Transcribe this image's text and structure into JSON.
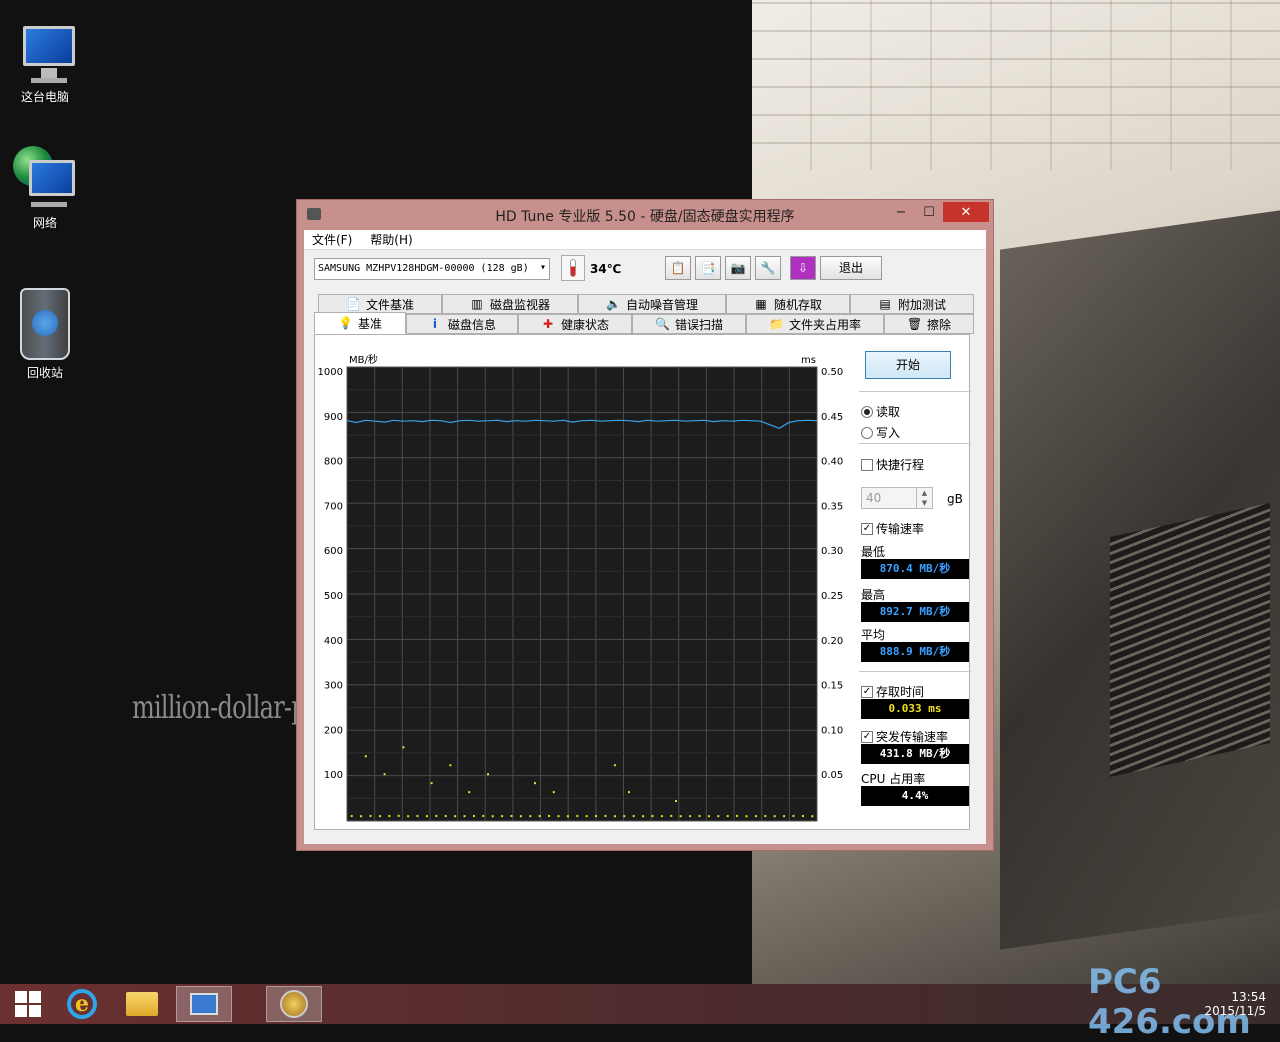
{
  "desktop": {
    "icons": [
      {
        "label": "这台电脑",
        "icon": "computer-icon"
      },
      {
        "label": "网络",
        "icon": "network-icon"
      },
      {
        "label": "回收站",
        "icon": "recycle-bin-icon"
      }
    ],
    "watermark": "million-dollar-p"
  },
  "window": {
    "title": "HD Tune 专业版 5.50 - 硬盘/固态硬盘实用程序",
    "controls": {
      "minimize": "−",
      "maximize": "☐",
      "close": "✕"
    },
    "menu": {
      "file": "文件(F)",
      "help": "帮助(H)"
    },
    "toolbar": {
      "drive": "SAMSUNG MZHPV128HDGM-00000 (128 gB)",
      "temperature": "34℃",
      "exit": "退出",
      "icons": [
        "copy-info-icon",
        "copy-all-icon",
        "camera-icon",
        "options-icon",
        "save-icon"
      ]
    },
    "tabs_top": [
      {
        "label": "文件基准",
        "icon": "file-benchmark-icon"
      },
      {
        "label": "磁盘监视器",
        "icon": "disk-monitor-icon"
      },
      {
        "label": "自动噪音管理",
        "icon": "speaker-icon"
      },
      {
        "label": "随机存取",
        "icon": "random-access-icon"
      },
      {
        "label": "附加测试",
        "icon": "extra-tests-icon"
      }
    ],
    "tabs_bottom": [
      {
        "label": "基准",
        "icon": "lightbulb-icon",
        "selected": true
      },
      {
        "label": "磁盘信息",
        "icon": "info-icon"
      },
      {
        "label": "健康状态",
        "icon": "health-icon"
      },
      {
        "label": "错误扫描",
        "icon": "magnifier-icon"
      },
      {
        "label": "文件夹占用率",
        "icon": "folder-icon"
      },
      {
        "label": "擦除",
        "icon": "trash-icon"
      }
    ],
    "side": {
      "start": "开始",
      "read": "读取",
      "write": "写入",
      "read_selected": true,
      "quick_label": "快捷行程",
      "quick_checked": false,
      "quick_value": "40",
      "quick_unit": "gB",
      "transfer_label": "传输速率",
      "transfer_checked": true,
      "min_label": "最低",
      "min_value": "870.4 MB/秒",
      "max_label": "最高",
      "max_value": "892.7 MB/秒",
      "avg_label": "平均",
      "avg_value": "888.9 MB/秒",
      "access_label": "存取时间",
      "access_checked": true,
      "access_value": "0.033 ms",
      "burst_label": "突发传输速率",
      "burst_checked": true,
      "burst_value": "431.8 MB/秒",
      "cpu_label": "CPU 占用率",
      "cpu_value": "4.4%"
    }
  },
  "chart_data": {
    "type": "line",
    "title": "",
    "ylabel_left": "MB/秒",
    "ylabel_right": "ms",
    "ylim_left": [
      0,
      1000
    ],
    "ylim_right": [
      0,
      0.5
    ],
    "yticks_left": [
      "1000",
      "900",
      "800",
      "700",
      "600",
      "500",
      "400",
      "300",
      "200",
      "100"
    ],
    "yticks_right": [
      "0.50",
      "0.45",
      "0.40",
      "0.35",
      "0.30",
      "0.25",
      "0.20",
      "0.15",
      "0.10",
      "0.05"
    ],
    "grid": true,
    "series": [
      {
        "color": "#3aa0e8",
        "kind": "line",
        "x": [
          0,
          2,
          4,
          6,
          8,
          10,
          12,
          14,
          16,
          18,
          20,
          22,
          24,
          26,
          28,
          30,
          32,
          34,
          36,
          38,
          40,
          42,
          44,
          46,
          48,
          50,
          52,
          54,
          56,
          58,
          60,
          62,
          64,
          66,
          68,
          70,
          72,
          74,
          76,
          78,
          80,
          82,
          84,
          86,
          88,
          90,
          92,
          94,
          96,
          98,
          100
        ],
        "values": [
          889,
          885,
          890,
          888,
          886,
          890,
          888,
          889,
          887,
          890,
          889,
          885,
          889,
          890,
          888,
          889,
          890,
          887,
          889,
          888,
          890,
          889,
          888,
          890,
          886,
          889,
          890,
          888,
          889,
          890,
          889,
          887,
          890,
          888,
          889,
          890,
          888,
          889,
          890,
          887,
          889,
          888,
          890,
          889,
          888,
          880,
          872,
          885,
          889,
          890,
          889
        ]
      },
      {
        "color": "#f0e020",
        "kind": "scatter",
        "x": [
          1,
          3,
          5,
          7,
          9,
          11,
          13,
          15,
          17,
          19,
          21,
          23,
          25,
          27,
          29,
          31,
          33,
          35,
          37,
          39,
          41,
          43,
          45,
          47,
          49,
          51,
          53,
          55,
          57,
          59,
          61,
          63,
          65,
          67,
          69,
          71,
          73,
          75,
          77,
          79,
          81,
          83,
          85,
          87,
          89,
          91,
          93,
          95,
          97,
          99,
          4,
          8,
          12,
          18,
          22,
          26,
          30,
          40,
          44,
          57,
          60,
          70
        ],
        "values": [
          0.0033,
          0.0031,
          0.0034,
          0.0032,
          0.0033,
          0.0035,
          0.0031,
          0.0033,
          0.0032,
          0.0034,
          0.0033,
          0.0031,
          0.0032,
          0.0033,
          0.0034,
          0.0031,
          0.0032,
          0.0033,
          0.0031,
          0.0032,
          0.0033,
          0.0034,
          0.0032,
          0.0031,
          0.0033,
          0.0032,
          0.0033,
          0.0034,
          0.0031,
          0.0032,
          0.0033,
          0.0031,
          0.0033,
          0.0032,
          0.0034,
          0.0031,
          0.0032,
          0.0033,
          0.0031,
          0.0032,
          0.0033,
          0.0034,
          0.0031,
          0.0032,
          0.0033,
          0.0031,
          0.0032,
          0.0034,
          0.0033,
          0.0031,
          0.07,
          0.05,
          0.08,
          0.04,
          0.06,
          0.03,
          0.05,
          0.04,
          0.03,
          0.06,
          0.03,
          0.02
        ]
      }
    ]
  },
  "taskbar": {
    "items": [
      {
        "name": "start-icon"
      },
      {
        "name": "internet-explorer-icon"
      },
      {
        "name": "file-explorer-icon"
      },
      {
        "name": "computer-app-icon",
        "active": true
      },
      {
        "name": "hdtune-icon",
        "active": true
      }
    ],
    "time": "13:54",
    "date": "2015/11/5",
    "brand_watermark": "PC6 426.com"
  }
}
